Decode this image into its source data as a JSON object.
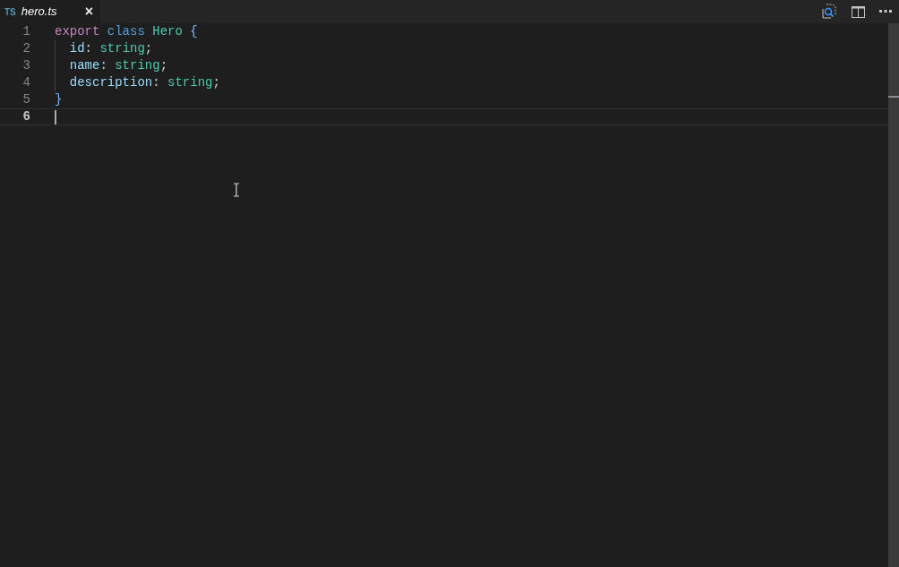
{
  "tab": {
    "badge": "TS",
    "title": "hero.ts",
    "close": "×",
    "selected": true
  },
  "lines": [
    {
      "number": "1",
      "current": false,
      "indent": false,
      "tokens": [
        {
          "text": "export ",
          "kind": "keyword"
        },
        {
          "text": "class ",
          "kind": "storage"
        },
        {
          "text": "Hero ",
          "kind": "type"
        },
        {
          "text": "{",
          "kind": "brace"
        }
      ]
    },
    {
      "number": "2",
      "current": false,
      "indent": true,
      "tokens": [
        {
          "text": "id",
          "kind": "property"
        },
        {
          "text": ": ",
          "kind": "plain"
        },
        {
          "text": "string",
          "kind": "type"
        },
        {
          "text": ";",
          "kind": "plain"
        }
      ]
    },
    {
      "number": "3",
      "current": false,
      "indent": true,
      "tokens": [
        {
          "text": "name",
          "kind": "property"
        },
        {
          "text": ": ",
          "kind": "plain"
        },
        {
          "text": "string",
          "kind": "type"
        },
        {
          "text": ";",
          "kind": "plain"
        }
      ]
    },
    {
      "number": "4",
      "current": false,
      "indent": true,
      "tokens": [
        {
          "text": "description",
          "kind": "property"
        },
        {
          "text": ": ",
          "kind": "plain"
        },
        {
          "text": "string",
          "kind": "type"
        },
        {
          "text": ";",
          "kind": "plain"
        }
      ]
    },
    {
      "number": "5",
      "current": false,
      "indent": false,
      "tokens": [
        {
          "text": "}",
          "kind": "brace"
        }
      ]
    },
    {
      "number": "6",
      "current": true,
      "indent": false
    }
  ]
}
